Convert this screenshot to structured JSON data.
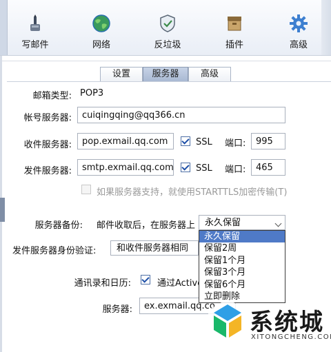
{
  "toolbar": {
    "items": [
      {
        "label": "写邮件",
        "icon": "compose-icon"
      },
      {
        "label": "网络",
        "icon": "globe-icon"
      },
      {
        "label": "反垃圾",
        "icon": "shield-icon"
      },
      {
        "label": "插件",
        "icon": "plugin-icon"
      },
      {
        "label": "高级",
        "icon": "gear-icon"
      }
    ]
  },
  "tabs": [
    {
      "label": "设置",
      "active": false
    },
    {
      "label": "服务器",
      "active": true
    },
    {
      "label": "高级",
      "active": false
    }
  ],
  "form": {
    "mailbox_type_label": "邮箱类型:",
    "mailbox_type_value": "POP3",
    "account_server_label": "帐号服务器:",
    "account_server_value": "cuiqingqing@qq366.cn",
    "incoming_label": "收件服务器:",
    "incoming_value": "pop.exmail.qq.com",
    "incoming_ssl_label": "SSL",
    "incoming_ssl_checked": true,
    "incoming_port_label": "端口:",
    "incoming_port_value": "995",
    "outgoing_label": "发件服务器:",
    "outgoing_value": "smtp.exmail.qq.com",
    "outgoing_ssl_label": "SSL",
    "outgoing_ssl_checked": true,
    "outgoing_port_label": "端口:",
    "outgoing_port_value": "465",
    "starttls_label": "如果服务器支持，就使用STARTTLS加密传输(T)",
    "starttls_checked": false,
    "backup_label": "服务器备份:",
    "backup_prefix": "邮件收取后，在服务器上",
    "backup_selected": "永久保留",
    "backup_options": [
      "永久保留",
      "保留2周",
      "保留1个月",
      "保留3个月",
      "保留6个月",
      "立即删除"
    ],
    "auth_label": "发件服务器身份验证:",
    "auth_selected": "和收件服务器相同",
    "contacts_label": "通讯录和日历:",
    "contacts_checkbox_label": "通过Active",
    "contacts_checked": true,
    "server_label": "服务器:",
    "server_value": "ex.exmail.qq.co"
  },
  "watermark": {
    "text": "系统城",
    "sub": "XITONGCHENG.COM"
  }
}
